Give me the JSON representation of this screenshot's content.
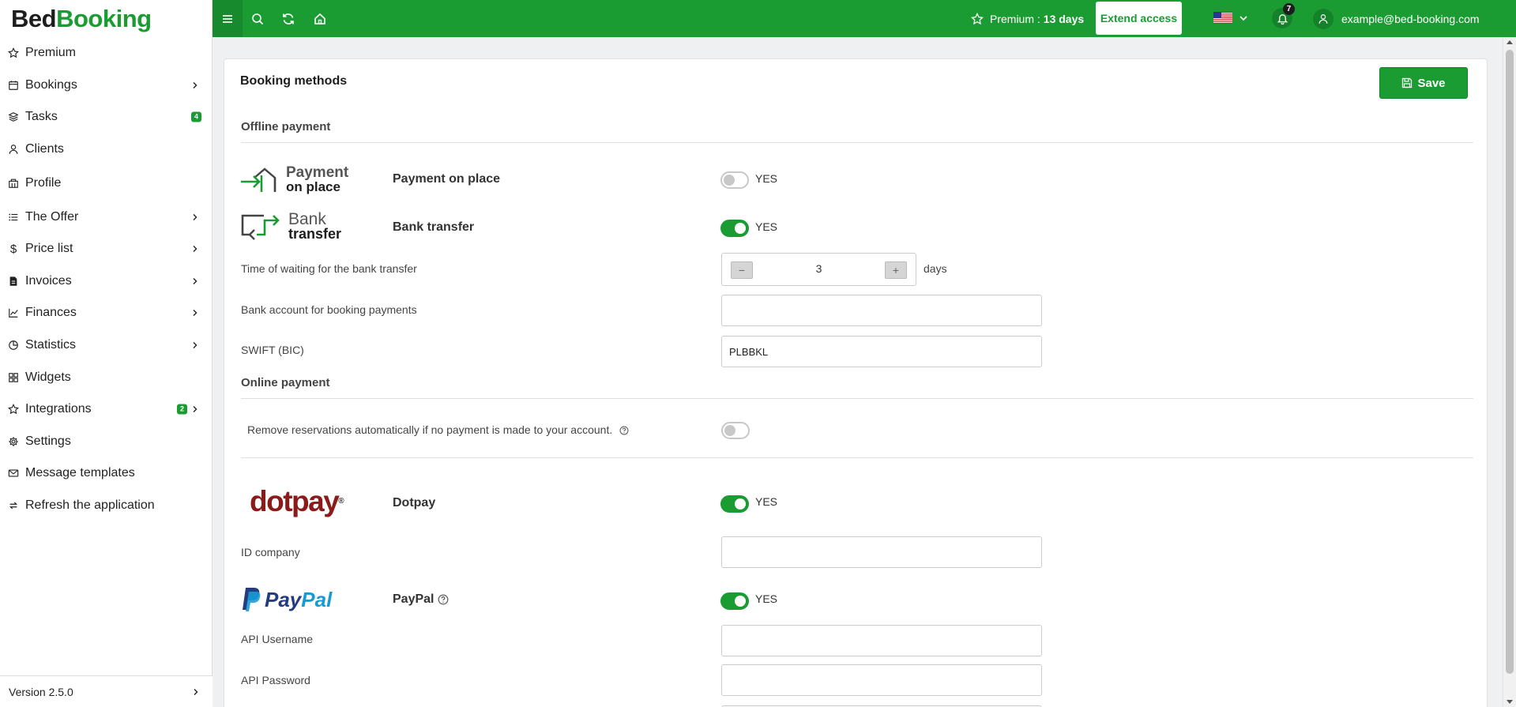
{
  "sidebar": {
    "logo_part1": "Bed",
    "logo_part2": "Booking",
    "items": [
      {
        "label": "Premium",
        "icon": "star-icon"
      },
      {
        "label": "Bookings",
        "icon": "calendar-icon"
      },
      {
        "label": "Tasks",
        "icon": "layers-icon",
        "badge": "4"
      },
      {
        "label": "Clients",
        "icon": "user-icon"
      },
      {
        "label": "Profile",
        "icon": "building-icon"
      },
      {
        "label": "The Offer",
        "icon": "list-icon"
      },
      {
        "label": "Price list",
        "icon": "dollar-icon"
      },
      {
        "label": "Invoices",
        "icon": "invoice-icon"
      },
      {
        "label": "Finances",
        "icon": "chart-line-icon"
      },
      {
        "label": "Statistics",
        "icon": "pie-icon"
      },
      {
        "label": "Widgets",
        "icon": "grid-icon"
      },
      {
        "label": "Integrations",
        "icon": "star-icon",
        "badge": "2"
      },
      {
        "label": "Settings",
        "icon": "gear-icon"
      },
      {
        "label": "Message templates",
        "icon": "mail-icon"
      },
      {
        "label": "Refresh the application",
        "icon": "refresh-icon"
      }
    ],
    "version": "Version 2.5.0"
  },
  "topbar": {
    "premium_label": "Premium :",
    "premium_days": "13 days",
    "extend_label": "Extend access",
    "notifications_count": "7",
    "user_email": "example@bed-booking.com"
  },
  "page": {
    "title": "Booking methods",
    "save_label": "Save",
    "offline_title": "Offline payment",
    "online_title": "Online payment",
    "yes_label": "YES",
    "payment_on_place": {
      "logo_line1": "Payment",
      "logo_line2": "on place",
      "label": "Payment on place",
      "enabled": false
    },
    "bank_transfer": {
      "logo_line1": "Bank",
      "logo_line2": "transfer",
      "label": "Bank transfer",
      "enabled": true
    },
    "waiting_label": "Time of waiting for the bank transfer",
    "waiting_value": "3",
    "waiting_unit": "days",
    "bank_account_label": "Bank account for booking payments",
    "bank_account_value": "",
    "swift_label": "SWIFT (BIC)",
    "swift_value": "PLBBKL",
    "remove_reservations_label": "Remove reservations automatically if no payment is made to your account.",
    "remove_reservations_enabled": false,
    "dotpay": {
      "logo_text": "dotpay",
      "label": "Dotpay",
      "enabled": true
    },
    "id_company_label": "ID company",
    "id_company_value": "",
    "paypal": {
      "logo_part1": "Pay",
      "logo_part2": "Pal",
      "label": "PayPal",
      "enabled": true
    },
    "api_username_label": "API Username",
    "api_username_value": "",
    "api_password_label": "API Password",
    "api_password_value": ""
  },
  "colors": {
    "brand_green": "#1a9c33",
    "dotpay_red": "#8b1a1a",
    "paypal_dark": "#253b80",
    "paypal_light": "#179bd7"
  }
}
